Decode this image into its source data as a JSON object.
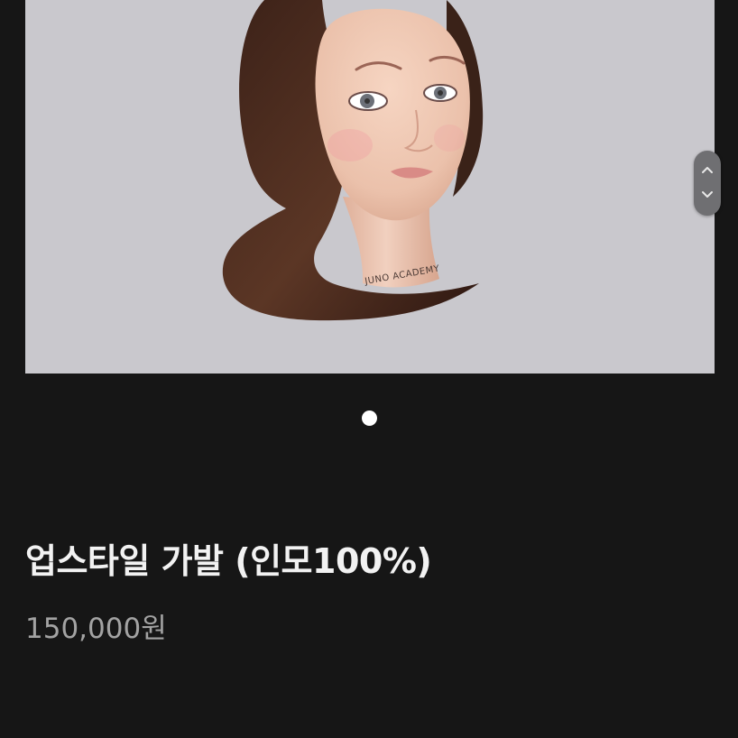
{
  "product": {
    "image_alt": "JUNO ACADEMY",
    "title": "업스타일 가발 (인모100%)",
    "price": "150,000원",
    "mannequin_neck_text": "JUNO ACADEMY"
  },
  "gallery": {
    "total_slides": 1,
    "current_slide": 1
  },
  "icons": {
    "scroll_up": "chevron-up-icon",
    "scroll_down": "chevron-down-icon"
  },
  "colors": {
    "background": "#161616",
    "image_background": "#c9c8cd",
    "title": "#f2f2f2",
    "price": "#a3a3a3",
    "pager_active": "#ffffff"
  }
}
